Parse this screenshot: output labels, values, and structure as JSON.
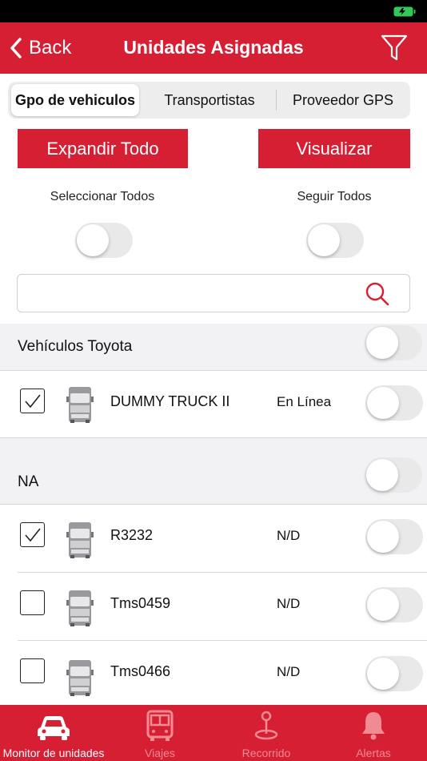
{
  "nav": {
    "back_label": "Back",
    "title": "Unidades Asignadas"
  },
  "segments": [
    "Gpo de vehiculos",
    "Transportistas",
    "Proveedor GPS"
  ],
  "buttons": {
    "expand": "Expandir Todo",
    "visualize": "Visualizar"
  },
  "toggles": {
    "select_all_label": "Seleccionar Todos",
    "follow_all_label": "Seguir Todos",
    "select_all_on": false,
    "follow_all_on": false
  },
  "search": {
    "placeholder": "",
    "value": ""
  },
  "groups": [
    {
      "title": "Vehículos Toyota",
      "units": [
        {
          "name": "DUMMY TRUCK II",
          "status": "En Línea",
          "checked": true
        }
      ]
    },
    {
      "title": "NA",
      "units": [
        {
          "name": "R3232",
          "status": "N/D",
          "checked": true
        },
        {
          "name": "Tms0459",
          "status": "N/D",
          "checked": false
        },
        {
          "name": "Tms0466",
          "status": "N/D",
          "checked": false
        }
      ]
    }
  ],
  "tabbar": [
    {
      "label": "Monitor de unidades",
      "icon": "car-icon",
      "active": true
    },
    {
      "label": "Viajes",
      "icon": "bus-icon",
      "active": false
    },
    {
      "label": "Recorrido",
      "icon": "route-pin-icon",
      "active": false
    },
    {
      "label": "Alertas",
      "icon": "bell-icon",
      "active": false
    }
  ],
  "colors": {
    "brand_red": "#d71f34",
    "battery_green": "#34c759"
  }
}
